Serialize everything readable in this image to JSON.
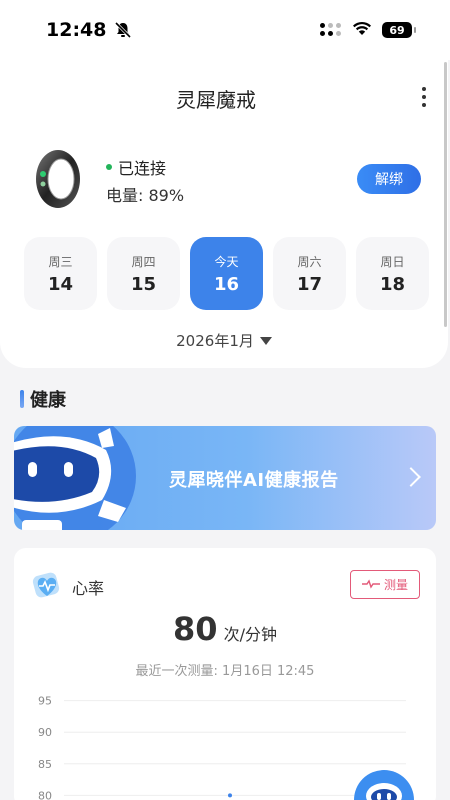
{
  "status": {
    "time": "12:48",
    "battery": "69"
  },
  "header": {
    "title": "灵犀魔戒"
  },
  "device": {
    "status": "已连接",
    "battery_label": "电量:",
    "battery_value": "89%",
    "unbind_label": "解绑"
  },
  "week": [
    {
      "weekday": "周三",
      "day": "14",
      "active": false
    },
    {
      "weekday": "周四",
      "day": "15",
      "active": false
    },
    {
      "weekday": "今天",
      "day": "16",
      "active": true
    },
    {
      "weekday": "周六",
      "day": "17",
      "active": false
    },
    {
      "weekday": "周日",
      "day": "18",
      "active": false
    }
  ],
  "month": "2026年1月",
  "section": {
    "title": "健康"
  },
  "ai_banner": {
    "text": "灵犀晓伴AI健康报告"
  },
  "heart_rate": {
    "title": "心率",
    "measure_label": "测量",
    "value": "80",
    "unit": "次/分钟",
    "last_measure": "最近一次测量: 1月16日 12:45"
  },
  "chart_data": {
    "type": "scatter",
    "y_ticks": [
      "95",
      "90",
      "85",
      "80"
    ],
    "ylim": [
      78,
      97
    ],
    "points": [
      {
        "x": 0.5,
        "y": 80
      }
    ],
    "grid": true,
    "colors": {
      "point": "#3d83ea",
      "grid": "#eeeeee"
    }
  },
  "colors": {
    "accent": "#3d83ea",
    "measure": "#e35a79",
    "connected": "#22b45a"
  }
}
